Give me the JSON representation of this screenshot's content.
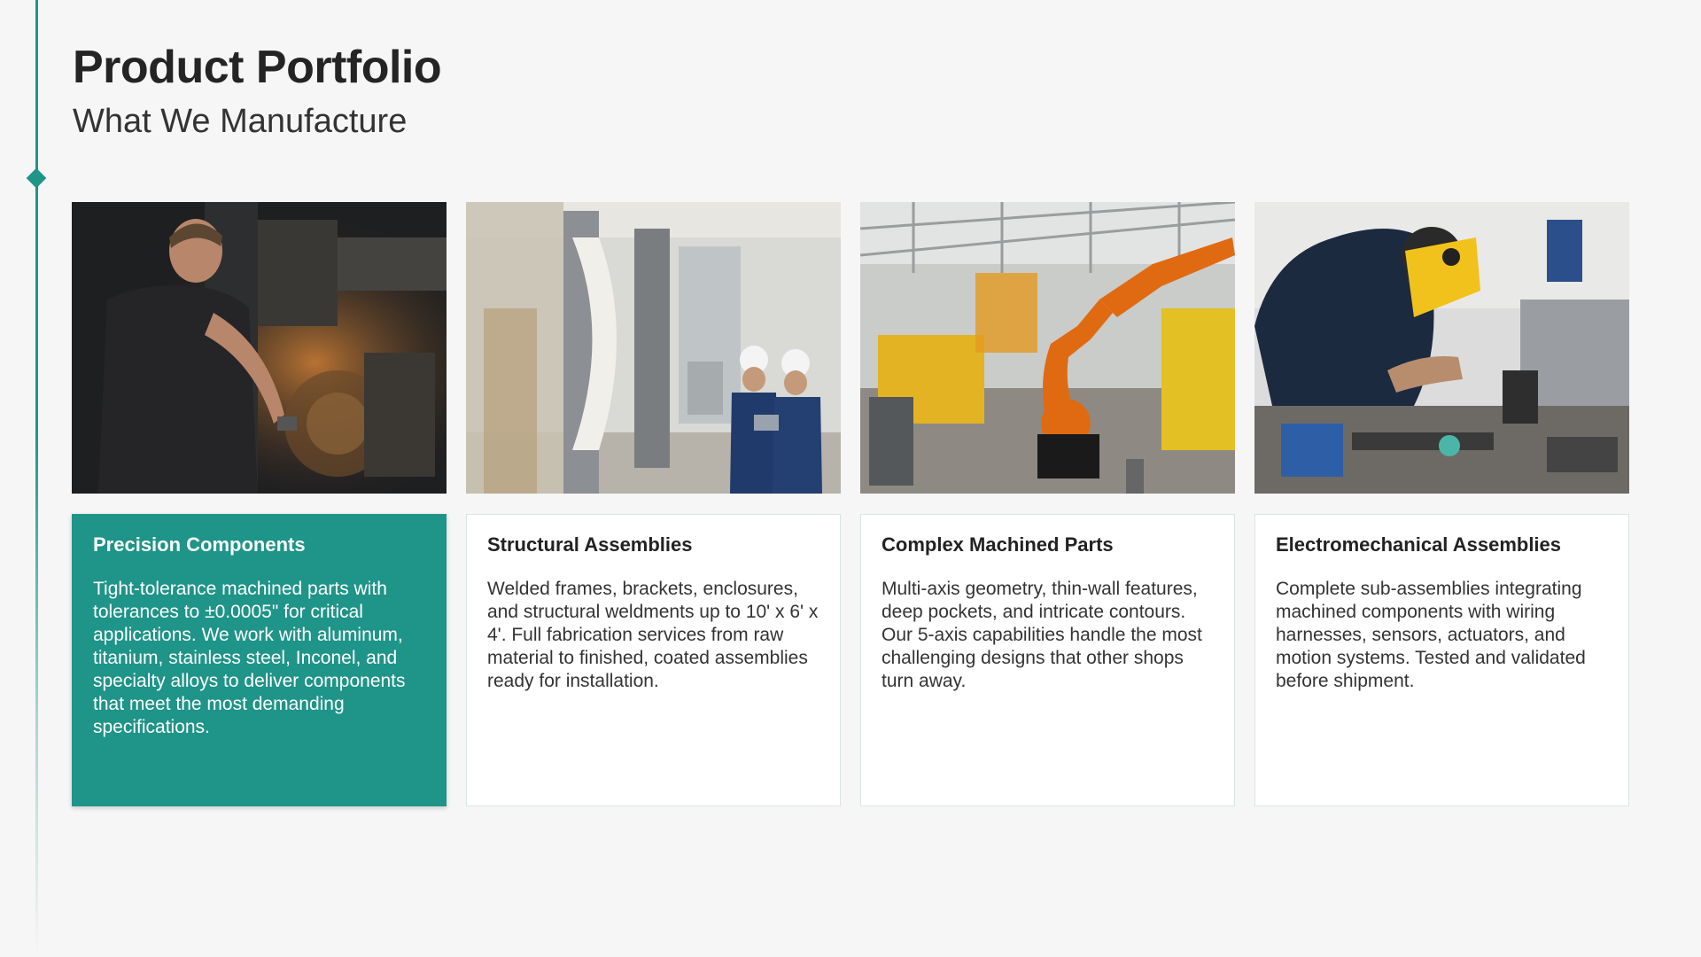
{
  "header": {
    "title": "Product Portfolio",
    "subtitle": "What We Manufacture"
  },
  "colors": {
    "accent": "#1f9488",
    "background": "#f6f6f6",
    "card": "#ffffff",
    "text": "#222222"
  },
  "products": [
    {
      "title": "Precision Components",
      "description": "Tight-tolerance machined parts with tolerances to ±0.0005\" for critical applications. We work with aluminum, titanium, stainless steel, Inconel, and specialty alloys to deliver components that meet the most demanding specifications.",
      "photo": "machinist-at-lathe-photo",
      "highlighted": true
    },
    {
      "title": "Structural Assemblies",
      "description": "Welded frames, brackets, enclosures, and structural weldments up to 10' x 6' x 4'. Full fabrication services from raw material to finished, coated assemblies ready for installation.",
      "photo": "engineers-in-factory-photo",
      "highlighted": false
    },
    {
      "title": "Complex Machined Parts",
      "description": "Multi-axis geometry, thin-wall features, deep pockets, and intricate contours. Our 5-axis capabilities handle the most challenging designs that other shops turn away.",
      "photo": "robotic-arm-assembly-line-photo",
      "highlighted": false
    },
    {
      "title": "Electromechanical Assemblies",
      "description": "Complete sub-assemblies integrating machined components with wiring harnesses, sensors, actuators, and motion systems. Tested and validated before shipment.",
      "photo": "welder-at-workbench-photo",
      "highlighted": false
    }
  ]
}
